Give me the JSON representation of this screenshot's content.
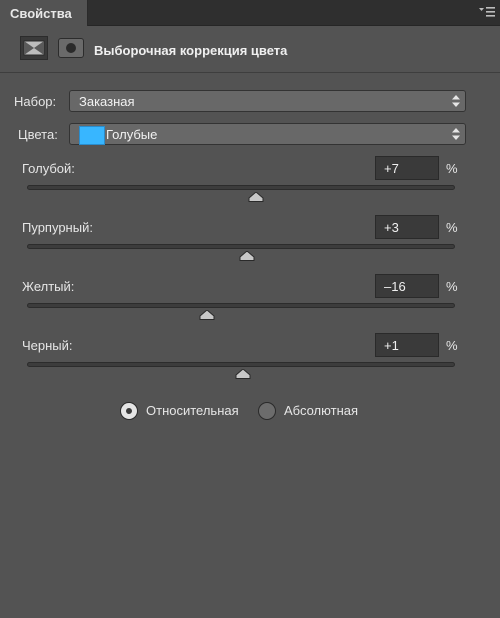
{
  "tab": {
    "title": "Свойства"
  },
  "header": {
    "title": "Выборочная коррекция цвета"
  },
  "preset": {
    "label": "Набор:",
    "value": "Заказная"
  },
  "colors": {
    "label": "Цвета:",
    "value": "Голубые",
    "swatch_color": "#38b6ff"
  },
  "sliders": [
    {
      "label": "Голубой:",
      "value": "+7",
      "unit": "%",
      "level": 7
    },
    {
      "label": "Пурпурный:",
      "value": "+3",
      "unit": "%",
      "level": 3
    },
    {
      "label": "Желтый:",
      "value": "–16",
      "unit": "%",
      "level": -16
    },
    {
      "label": "Черный:",
      "value": "+1",
      "unit": "%",
      "level": 1
    }
  ],
  "method": {
    "relative_label": "Относительная",
    "absolute_label": "Абсолютная",
    "selected": "relative"
  }
}
